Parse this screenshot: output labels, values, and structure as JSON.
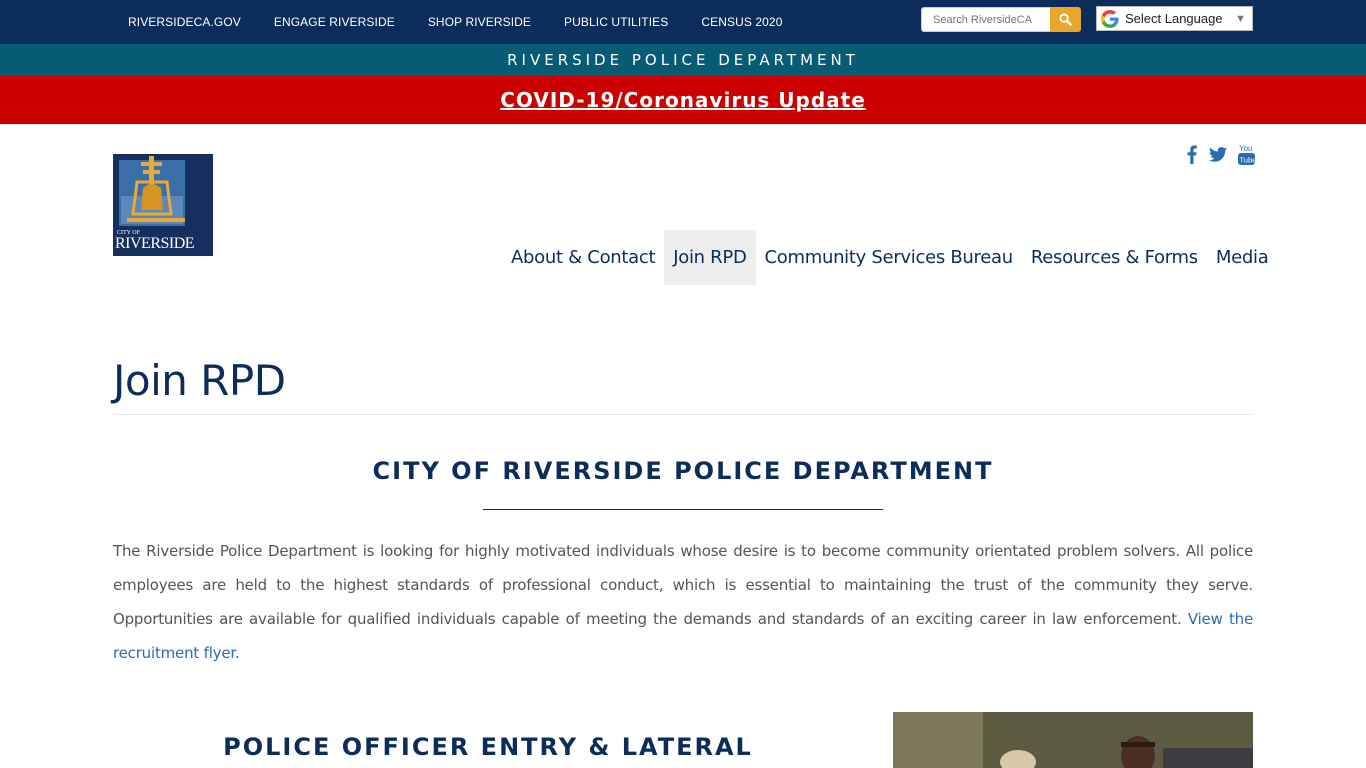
{
  "utility_nav": {
    "links": [
      "RIVERSIDECA.GOV",
      "ENGAGE RIVERSIDE",
      "SHOP RIVERSIDE",
      "PUBLIC UTILITIES",
      "CENSUS 2020"
    ],
    "search_placeholder": "Search RiversideCA",
    "search_icon": "search-icon",
    "language_label": "Select Language",
    "language_arrow": "▼"
  },
  "dept_banner": "RIVERSIDE POLICE DEPARTMENT",
  "covid_banner": "COVID-19/Coronavirus Update",
  "logo": {
    "small_text": "CITY OF",
    "big_text": "RIVERSIDE"
  },
  "social": [
    "facebook-icon",
    "twitter-icon",
    "youtube-icon"
  ],
  "main_nav": {
    "items": [
      "About & Contact",
      "Join RPD",
      "Community Services Bureau",
      "Resources & Forms",
      "Media"
    ],
    "active": "Join RPD"
  },
  "page": {
    "title": "Join RPD",
    "section_heading": "CITY OF RIVERSIDE POLICE DEPARTMENT",
    "intro": "The Riverside Police Department is looking for highly motivated individuals whose desire is to become community orientated problem solvers. All police employees are held to the highest standards of professional conduct, which is essential to maintaining the trust of the community they serve. Opportunities are available for qualified individuals capable of meeting the demands and standards of an exciting career in law enforcement. ",
    "intro_link": "View the recruitment flyer",
    "intro_end": ".",
    "sub_heading": "POLICE OFFICER ENTRY & LATERAL"
  },
  "colors": {
    "navy": "#0c2d5b",
    "teal": "#075b74",
    "red": "#cc0000",
    "gold": "#e8a62b",
    "link": "#2b6cb0"
  }
}
